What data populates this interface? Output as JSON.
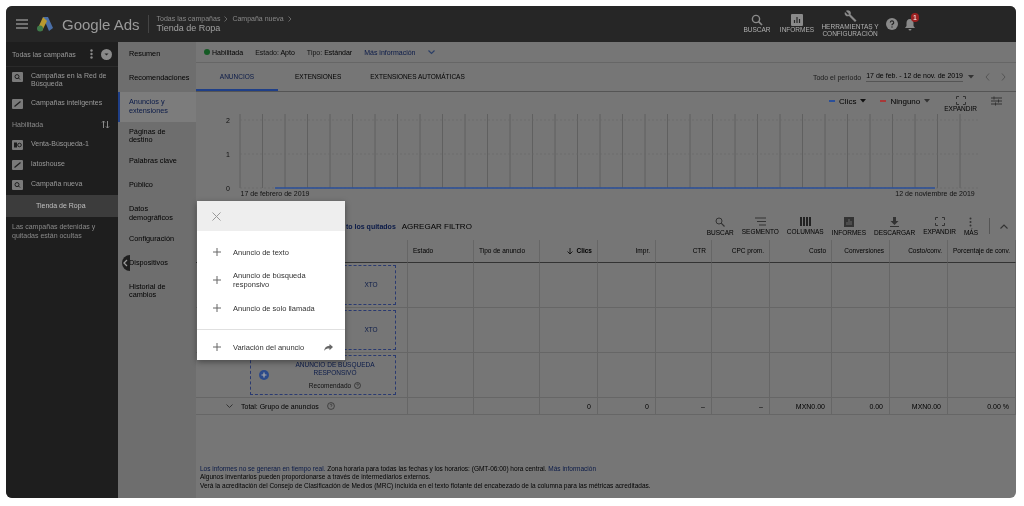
{
  "topbar": {
    "product": "Google Ads",
    "breadcrumb": [
      "Todas las campañas",
      "Campaña nueva"
    ],
    "title": "Tienda de Ropa",
    "tools": [
      {
        "kind": "search",
        "label": "BUSCAR"
      },
      {
        "kind": "reports",
        "label": "INFORMES"
      },
      {
        "kind": "tools",
        "label": "HERRAMIENTAS Y CONFIGURACIÓN"
      },
      {
        "kind": "help"
      },
      {
        "kind": "bell",
        "badge": "1"
      }
    ]
  },
  "sidebar": {
    "header": "Todas las campañas",
    "items": [
      {
        "kind": "search",
        "label": "Campañas en la Red de Búsqueda",
        "selected": false
      },
      {
        "kind": "smart",
        "label": "Campañas inteligentes",
        "selected": false
      },
      {
        "kind": "heading",
        "label": "Habilitada"
      },
      {
        "kind": "shopping",
        "label": "Venta-Búsqueda-1",
        "selected": false
      },
      {
        "kind": "smart",
        "label": "latoshouse",
        "selected": false
      },
      {
        "kind": "search",
        "label": "Campaña nueva",
        "selected": false
      },
      {
        "kind": "child",
        "label": "Tienda de Ropa",
        "selected": true
      }
    ],
    "note": "Las campañas detenidas y quitadas están ocultas"
  },
  "nav": [
    {
      "label": "Resumen",
      "selected": false
    },
    {
      "label": "Recomendaciones",
      "selected": false
    },
    {
      "label": "Anuncios y extensiones",
      "selected": true
    },
    {
      "label": "Páginas de destino",
      "selected": false
    },
    {
      "label": "Palabras clave",
      "selected": false
    },
    {
      "label": "Público",
      "selected": false
    },
    {
      "label": "Datos demográficos",
      "selected": false
    },
    {
      "label": "Configuración",
      "selected": false
    },
    {
      "label": "Dispositivos",
      "selected": false
    },
    {
      "label": "Historial de cambios",
      "selected": false
    }
  ],
  "status": {
    "state": "Habilitada",
    "status_label": "Estado:",
    "status_value": "Apto",
    "type_label": "Tipo:",
    "type_value": "Estándar",
    "more": "Más información"
  },
  "tabs": [
    {
      "label": "ANUNCIOS",
      "selected": true
    },
    {
      "label": "EXTENSIONES",
      "selected": false
    },
    {
      "label": "EXTENSIONES AUTOMÁTICAS",
      "selected": false
    }
  ],
  "date_range": {
    "label": "Todo el período",
    "value": "17 de feb. - 12 de nov. de 2019"
  },
  "chart": {
    "metrics": [
      {
        "label": "Ninguno",
        "color": "#a83838"
      }
    ],
    "expand_label": "EXPANDIR",
    "chart_data": {
      "type": "line",
      "x": [
        "17 de febrero de 2019",
        "12 de noviembre de 2019"
      ],
      "yticks": [
        0,
        1,
        2
      ],
      "ylim": [
        0,
        2
      ],
      "series": [
        {
          "name": "Clics",
          "color": "#2a4f9a",
          "values": [
            0,
            0
          ]
        }
      ]
    }
  },
  "filter": {
    "text": "to los quitados",
    "add": "AGREGAR FILTRO"
  },
  "toolbar": [
    {
      "kind": "search",
      "label": "BUSCAR"
    },
    {
      "kind": "segment",
      "label": "SEGMENTO"
    },
    {
      "kind": "columns",
      "label": "COLUMNAS"
    },
    {
      "kind": "reports",
      "label": "INFORMES"
    },
    {
      "kind": "download",
      "label": "DESCARGAR"
    },
    {
      "kind": "expand",
      "label": "EXPANDIR"
    },
    {
      "kind": "more",
      "label": "MÁS"
    }
  ],
  "table": {
    "columns": [
      {
        "label": "Estado",
        "sorted": false
      },
      {
        "label": "Tipo de anuncio",
        "sorted": false
      },
      {
        "label": "Clics",
        "sorted": true
      },
      {
        "label": "Impr.",
        "sorted": false
      },
      {
        "label": "CTR",
        "sorted": false
      },
      {
        "label": "CPC prom.",
        "sorted": false
      },
      {
        "label": "Costo",
        "sorted": false
      },
      {
        "label": "Conversiones",
        "sorted": false
      },
      {
        "label": "Costo/conv.",
        "sorted": false
      },
      {
        "label": "Porcentaje de conv.",
        "sorted": false
      }
    ],
    "ad_rows": [
      {
        "kind": "covered",
        "title": "XTO"
      },
      {
        "kind": "covered",
        "title": "XTO"
      },
      {
        "kind": "full",
        "title": "ANUNCIO DE BÚSQUEDA RESPONSIVO",
        "note": "Recomendado"
      }
    ],
    "total": {
      "label": "Total: Grupo de anuncios",
      "cells": [
        "0",
        "0",
        "–",
        "–",
        "MXN0.00",
        "0.00",
        "MXN0.00",
        "0.00 %"
      ]
    }
  },
  "footer": {
    "link": "Los informes no se generan en tiempo real.",
    "line1": "Zona horaria para todas las fechas y los horarios: (GMT-06:00) hora central.",
    "more": "Más información",
    "line2": "Algunos inventarios pueden proporcionarse a través de intermediarios externos.",
    "line3": "Verá la acreditación del Consejo de Clasificación de Medios (MRC) incluida en el texto flotante del encabezado de la columna para las métricas acreditadas."
  },
  "dialog": {
    "items": [
      {
        "label": "Anuncio de texto",
        "kind": "plain"
      },
      {
        "label": "Anuncio de búsqueda responsivo",
        "kind": "plain"
      },
      {
        "label": "Anuncio de solo llamada",
        "kind": "plain"
      },
      {
        "label": "Variación del anuncio",
        "kind": "external"
      }
    ]
  }
}
